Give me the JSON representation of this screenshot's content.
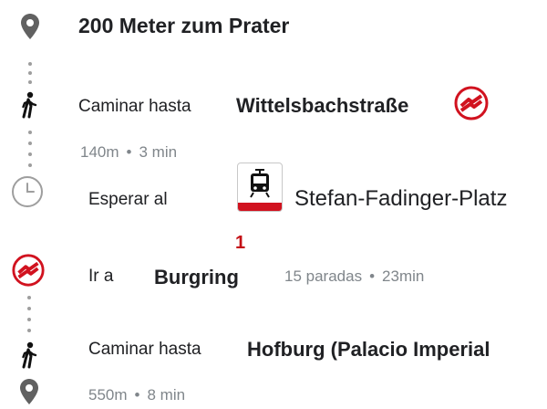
{
  "header": {
    "title": "200 Meter zum Prater",
    "icon": "location-pin-icon"
  },
  "steps": {
    "walk1": {
      "action": "Caminar hasta",
      "destination": "Wittelsbachstraße",
      "distance": "140m",
      "duration": "3 min",
      "icon": "walk-icon",
      "badge_icon": "metro-logo-icon"
    },
    "wait": {
      "action": "Esperar al",
      "stop": "Stefan-Fadinger-Platz",
      "line_number": "1",
      "icon": "clock-icon",
      "badge_icon": "tram-icon"
    },
    "ride": {
      "action": "Ir a",
      "destination": "Burgring",
      "stops": "15 paradas",
      "duration": "23min",
      "icon": "metro-logo-icon"
    },
    "walk2": {
      "action": "Caminar hasta",
      "destination": "Hofburg (Palacio Imperial",
      "distance": "550m",
      "duration": "8 min",
      "icon": "walk-icon",
      "end_icon": "location-pin-icon"
    }
  },
  "separator": "•",
  "colors": {
    "text": "#202124",
    "secondary": "#80868b",
    "icon_gray": "#616161",
    "transit_red": "#d1121f"
  }
}
